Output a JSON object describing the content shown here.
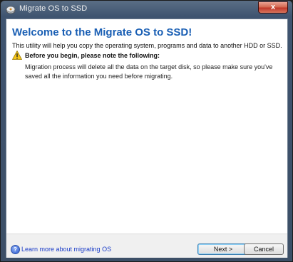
{
  "window": {
    "title": "Migrate OS to SSD",
    "close_label": "x"
  },
  "content": {
    "heading": "Welcome to the Migrate OS to SSD!",
    "intro": "This utility will help you copy the operating system, programs and data to another HDD or SSD.",
    "warning_title": "Before you begin, please note the following:",
    "warning_body": "Migration process will delete all the data on the target disk, so please make sure you've saved all the information you need before migrating."
  },
  "footer": {
    "help_icon": "help-question-icon",
    "help_link": "Learn more about migrating OS",
    "next_label": "Next >",
    "cancel_label": "Cancel"
  },
  "colors": {
    "heading": "#1a5fb4",
    "link": "#1a3cc8",
    "titlebar": "#3f5470"
  }
}
